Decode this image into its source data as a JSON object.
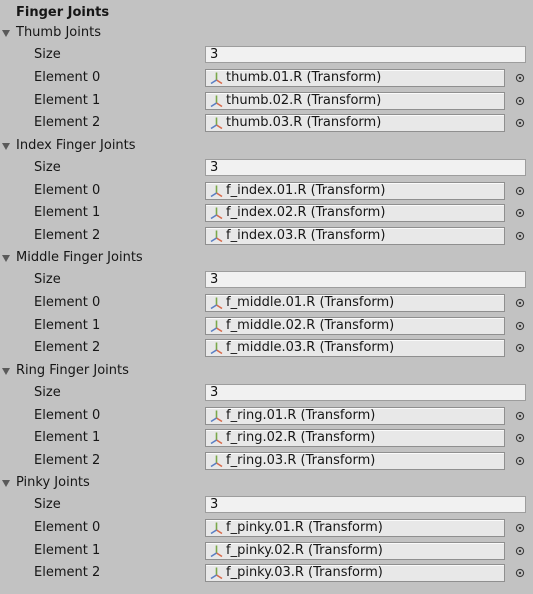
{
  "title": "Finger Joints",
  "colors": {
    "background": "#c2c2c2",
    "field_background": "#e8e8e8",
    "int_field_background": "#f1f1f1",
    "transform_icon_x": "#d86a4a",
    "transform_icon_y": "#7aa84a",
    "transform_icon_z": "#5a7fc4"
  },
  "icons": {
    "foldout": "triangle-down-icon",
    "transform": "transform-axes-icon",
    "picker": "object-picker-icon"
  },
  "groups": [
    {
      "label": "Thumb Joints",
      "size_label": "Size",
      "size": "3",
      "elements": [
        {
          "label": "Element 0",
          "value": "thumb.01.R (Transform)"
        },
        {
          "label": "Element 1",
          "value": "thumb.02.R (Transform)"
        },
        {
          "label": "Element 2",
          "value": "thumb.03.R (Transform)"
        }
      ]
    },
    {
      "label": "Index Finger Joints",
      "size_label": "Size",
      "size": "3",
      "elements": [
        {
          "label": "Element 0",
          "value": "f_index.01.R (Transform)"
        },
        {
          "label": "Element 1",
          "value": "f_index.02.R (Transform)"
        },
        {
          "label": "Element 2",
          "value": "f_index.03.R (Transform)"
        }
      ]
    },
    {
      "label": "Middle Finger Joints",
      "size_label": "Size",
      "size": "3",
      "elements": [
        {
          "label": "Element 0",
          "value": "f_middle.01.R (Transform)"
        },
        {
          "label": "Element 1",
          "value": "f_middle.02.R (Transform)"
        },
        {
          "label": "Element 2",
          "value": "f_middle.03.R (Transform)"
        }
      ]
    },
    {
      "label": "Ring Finger Joints",
      "size_label": "Size",
      "size": "3",
      "elements": [
        {
          "label": "Element 0",
          "value": "f_ring.01.R (Transform)"
        },
        {
          "label": "Element 1",
          "value": "f_ring.02.R (Transform)"
        },
        {
          "label": "Element 2",
          "value": "f_ring.03.R (Transform)"
        }
      ]
    },
    {
      "label": "Pinky Joints",
      "size_label": "Size",
      "size": "3",
      "elements": [
        {
          "label": "Element 0",
          "value": "f_pinky.01.R (Transform)"
        },
        {
          "label": "Element 1",
          "value": "f_pinky.02.R (Transform)"
        },
        {
          "label": "Element 2",
          "value": "f_pinky.03.R (Transform)"
        }
      ]
    }
  ]
}
